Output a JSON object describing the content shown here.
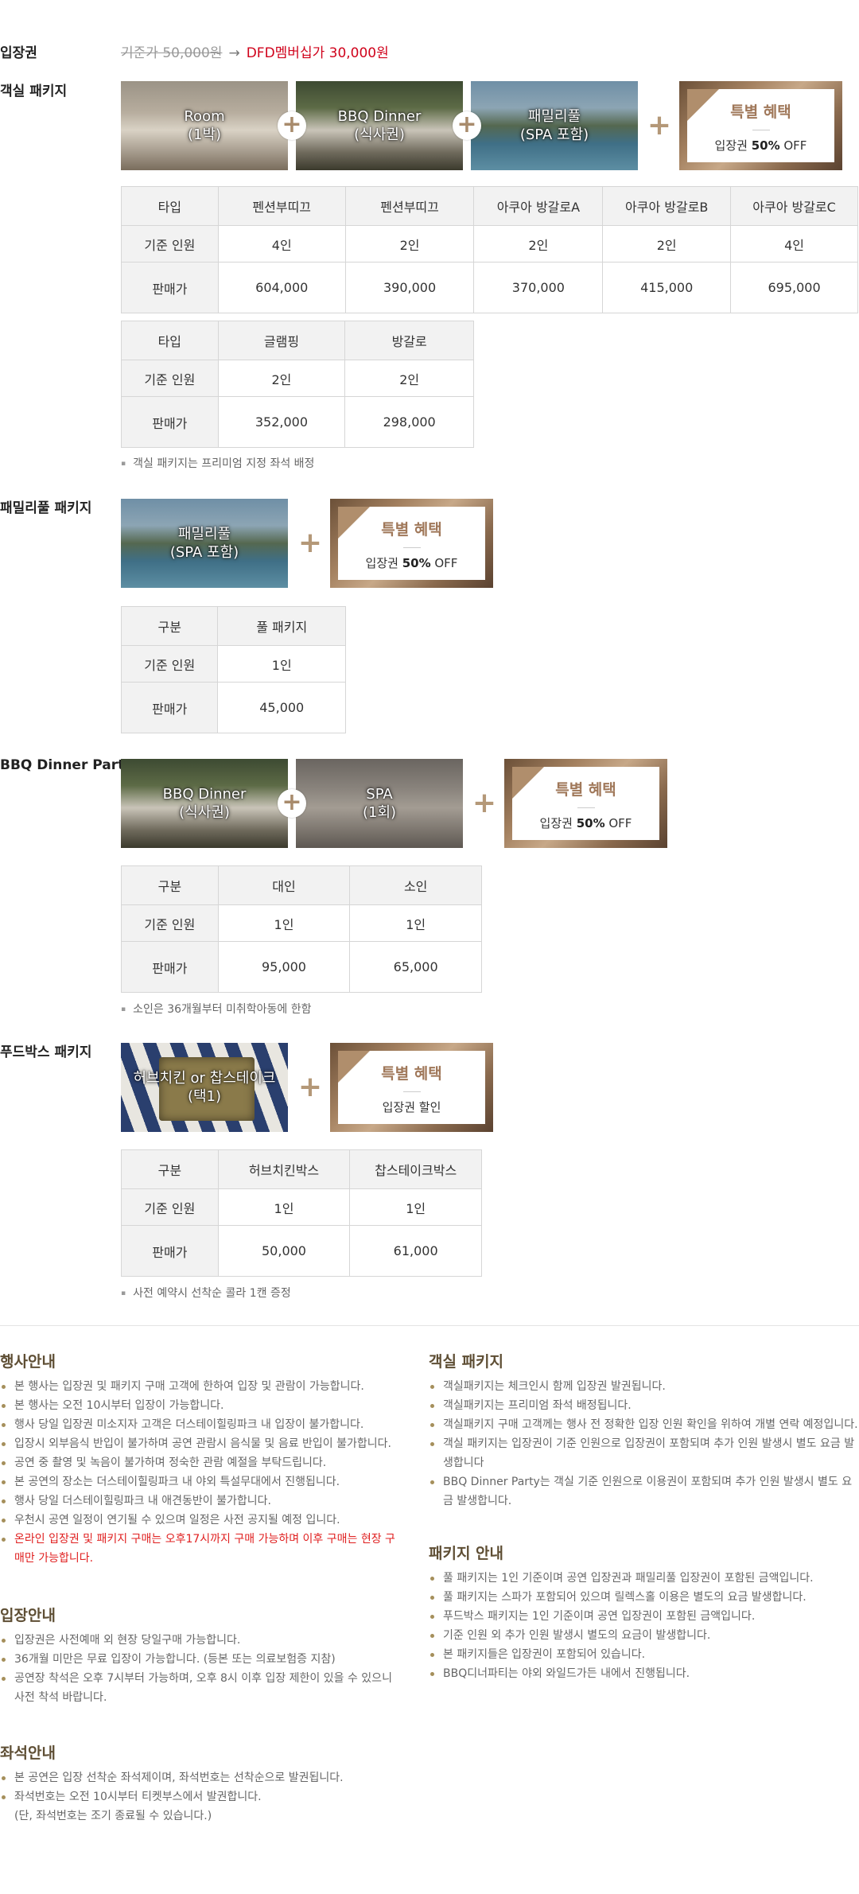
{
  "admission": {
    "label": "입장권",
    "old_price": "기준가 50,000원",
    "arrow": "→",
    "new_price": "DFD멤버십가 30,000원"
  },
  "room_package": {
    "label": "객실 패키지",
    "images": [
      {
        "line1": "Room",
        "line2": "(1박)"
      },
      {
        "line1": "BBQ Dinner",
        "line2": "(식사권)"
      },
      {
        "line1": "패밀리풀",
        "line2": "(SPA 포함)"
      }
    ],
    "plus": "+",
    "benefit": {
      "title": "특별 혜택",
      "desc_prefix": "입장권 ",
      "desc_bold": "50%",
      "desc_suffix": " OFF"
    },
    "table1": {
      "head": [
        "타입",
        "펜션부띠끄",
        "펜션부띠끄",
        "아쿠아 방갈로A",
        "아쿠아 방갈로B",
        "아쿠아 방갈로C"
      ],
      "people": [
        "기준 인원",
        "4인",
        "2인",
        "2인",
        "2인",
        "4인"
      ],
      "price": [
        "판매가",
        "604,000",
        "390,000",
        "370,000",
        "415,000",
        "695,000"
      ]
    },
    "table2": {
      "head": [
        "타입",
        "글램핑",
        "방갈로"
      ],
      "people": [
        "기준 인원",
        "2인",
        "2인"
      ],
      "price": [
        "판매가",
        "352,000",
        "298,000"
      ]
    },
    "note": "객실 패키지는 프리미엄 지정 좌석 배정"
  },
  "family_package": {
    "label": "패밀리풀 패키지",
    "images": [
      {
        "line1": "패밀리풀",
        "line2": "(SPA 포함)"
      }
    ],
    "benefit": {
      "title": "특별 혜택",
      "desc_prefix": "입장권 ",
      "desc_bold": "50%",
      "desc_suffix": " OFF"
    },
    "table": {
      "head": [
        "구분",
        "풀 패키지"
      ],
      "people": [
        "기준 인원",
        "1인"
      ],
      "price": [
        "판매가",
        "45,000"
      ]
    }
  },
  "bbq_package": {
    "label": "BBQ Dinner Party",
    "images": [
      {
        "line1": "BBQ Dinner",
        "line2": "(식사권)"
      },
      {
        "line1": "SPA",
        "line2": "(1회)"
      }
    ],
    "benefit": {
      "title": "특별 혜택",
      "desc_prefix": "입장권 ",
      "desc_bold": "50%",
      "desc_suffix": " OFF"
    },
    "table": {
      "head": [
        "구분",
        "대인",
        "소인"
      ],
      "people": [
        "기준 인원",
        "1인",
        "1인"
      ],
      "price": [
        "판매가",
        "95,000",
        "65,000"
      ]
    },
    "note": "소인은 36개월부터 미취학아동에 한함"
  },
  "foodbox_package": {
    "label": "푸드박스 패키지",
    "images": [
      {
        "line1": "허브치킨 or 찹스테이크",
        "line2": "(택1)"
      }
    ],
    "benefit": {
      "title": "특별 혜택",
      "desc": "입장권 할인"
    },
    "table": {
      "head": [
        "구분",
        "허브치킨박스",
        "찹스테이크박스"
      ],
      "people": [
        "기준 인원",
        "1인",
        "1인"
      ],
      "price": [
        "판매가",
        "50,000",
        "61,000"
      ]
    },
    "note": "사전 예약시 선착순 콜라 1캔 증정"
  },
  "event_info": {
    "title": "행사안내",
    "items": [
      "본 행사는 입장권 및 패키지 구매 고객에 한하여 입장 및 관람이 가능합니다.",
      "본 행사는 오전 10시부터 입장이 가능합니다.",
      "행사 당일 입장권 미소지자 고객은 더스테이힐링파크 내 입장이 불가합니다.",
      "입장시 외부음식 반입이 불가하며 공연 관람시 음식물 및 음료 반입이 불가합니다.",
      "공연 중 촬영 및 녹음이 불가하며 정숙한 관람 예절을 부탁드립니다.",
      "본 공연의 장소는 더스테이힐링파크 내 야외 특설무대에서 진행됩니다.",
      "행사 당일 더스테이힐링파크 내 애견동반이 불가합니다.",
      "우천시 공연 일정이 연기될 수 있으며 일정은 사전 공지될 예정 입니다."
    ],
    "red_item": "온라인 입장권 및 패키지 구매는 오후17시까지 구매 가능하며 이후 구매는 현장 구매만 가능합니다."
  },
  "admission_info": {
    "title": "입장안내",
    "items": [
      "입장권은 사전예매 외 현장 당일구매 가능합니다.",
      "36개월 미만은 무료 입장이 가능합니다. (등본 또는 의료보험증 지참)",
      "공연장 착석은 오후 7시부터 가능하며, 오후 8시 이후 입장 제한이 있을 수 있으니 사전 착석 바랍니다."
    ]
  },
  "seat_info": {
    "title": "좌석안내",
    "items": [
      "본 공연은 입장 선착순 좌석제이며,  좌석번호는 선착순으로 발권됩니다.",
      "좌석번호는 오전 10시부터 티켓부스에서 발권합니다."
    ],
    "sub": "(단, 좌석번호는 조기 종료될 수 있습니다.)"
  },
  "room_info": {
    "title": "객실 패키지",
    "items": [
      "객실패키지는 체크인시 함께 입장권 발권됩니다.",
      "객실패키지는 프리미엄 좌석 배정됩니다.",
      "객실패키지 구매 고객께는 행사 전 정확한 입장 인원 확인을 위하여 개별 연락 예정입니다.",
      "객실 패키지는 입장권이 기준 인원으로 입장권이 포함되며 추가 인원 발생시 별도 요금 발생합니다",
      "BBQ Dinner Party는 객실 기준 인원으로 이용권이 포함되며 추가 인원 발생시 별도 요금 발생합니다."
    ]
  },
  "package_info": {
    "title": "패키지 안내",
    "items": [
      "풀 패키지는 1인 기준이며 공연 입장권과 패밀리풀 입장권이 포함된 금액입니다.",
      "풀 패키지는 스파가 포함되어 있으며 릴렉스홀 이용은 별도의 요금 발생합니다.",
      "푸드박스 패키지는 1인 기준이며 공연 입장권이 포함된 금액입니다.",
      "기준 인원 외 추가 인원 발생시 별도의 요금이 발생합니다.",
      "본 패키지들은 입장권이 포함되어 있습니다.",
      "BBQ디너파티는 야외 와일드가든 내에서 진행됩니다."
    ]
  }
}
